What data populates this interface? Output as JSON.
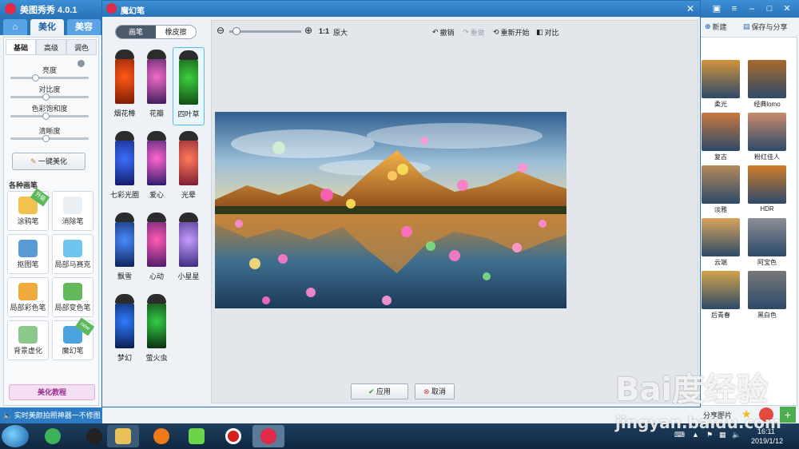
{
  "app": {
    "title": "美图秀秀 4.0.1",
    "tabs": [
      "美化",
      "美容"
    ],
    "toolbar_right": {
      "new_label": "新建",
      "save_label": "保存与分享"
    },
    "left_panel": {
      "sub_tabs": [
        "基础",
        "高级",
        "调色"
      ],
      "sliders": [
        {
          "label": "亮度",
          "value": 0.3
        },
        {
          "label": "对比度",
          "value": 0.45
        },
        {
          "label": "色彩饱和度",
          "value": 0.45
        },
        {
          "label": "清晰度",
          "value": 0.45
        }
      ],
      "one_key_label": "一键美化",
      "brush_header": "各种画笔",
      "brushes": [
        {
          "label": "涂鸦笔",
          "badge": "升级",
          "color": "#f2c14e"
        },
        {
          "label": "消除笔",
          "badge": "",
          "color": "#e9eef3"
        },
        {
          "label": "抠图笔",
          "badge": "",
          "color": "#5b9bd5"
        },
        {
          "label": "局部马赛克",
          "badge": "",
          "color": "#6ec5f0"
        },
        {
          "label": "局部彩色笔",
          "badge": "",
          "color": "#f0a93c"
        },
        {
          "label": "局部变色笔",
          "badge": "",
          "color": "#62b85a"
        },
        {
          "label": "背景虚化",
          "badge": "",
          "color": "#8bc98a"
        },
        {
          "label": "魔幻笔",
          "badge": "new",
          "color": "#4aa3df"
        }
      ],
      "tutorial_label": "美化教程"
    },
    "right_panel": {
      "effects": [
        {
          "label": "柔光",
          "tint": "#d4923a"
        },
        {
          "label": "经典lomo",
          "tint": "#a86a2a"
        },
        {
          "label": "复古",
          "tint": "#c9783d"
        },
        {
          "label": "粉红佳人",
          "tint": "#c98a6a"
        },
        {
          "label": "淡雅",
          "tint": "#b58a5a"
        },
        {
          "label": "HDR",
          "tint": "#d07c2a"
        },
        {
          "label": "云端",
          "tint": "#d9a55a"
        },
        {
          "label": "阿宝色",
          "tint": "#8c8f94"
        },
        {
          "label": "后青春",
          "tint": "#d3a24a"
        },
        {
          "label": "黑白色",
          "tint": "#777777"
        }
      ],
      "share_label": "分享图片"
    },
    "status_text": "实时美颜拍照神器一不修图"
  },
  "dialog": {
    "title": "魔幻笔",
    "modes": [
      "画笔",
      "橡皮擦"
    ],
    "pens": [
      {
        "label": "烟花棒",
        "c1": "#ff5a1a",
        "c2": "#7a1a00",
        "selected": false
      },
      {
        "label": "花瓣",
        "c1": "#f06cc4",
        "c2": "#3a1a5a",
        "selected": false
      },
      {
        "label": "四叶草",
        "c1": "#3ecf3e",
        "c2": "#0f4a12",
        "selected": true
      },
      {
        "label": "七彩光圈",
        "c1": "#3b6fff",
        "c2": "#111a66",
        "selected": false
      },
      {
        "label": "爱心",
        "c1": "#ff66cc",
        "c2": "#2a1a6a",
        "selected": false
      },
      {
        "label": "光晕",
        "c1": "#ff7a5a",
        "c2": "#7a1a30",
        "selected": false
      },
      {
        "label": "飘雪",
        "c1": "#4a8cff",
        "c2": "#0c1f55",
        "selected": false
      },
      {
        "label": "心动",
        "c1": "#ff5ab0",
        "c2": "#4a1a6a",
        "selected": false
      },
      {
        "label": "小星星",
        "c1": "#c49bff",
        "c2": "#3a2a7a",
        "selected": false
      },
      {
        "label": "梦幻",
        "c1": "#2e7bff",
        "c2": "#0a1a4a",
        "selected": false
      },
      {
        "label": "萤火虫",
        "c1": "#33cc44",
        "c2": "#0a2a10",
        "selected": false
      }
    ],
    "toolbar": {
      "ratio_label": "1:1",
      "original_label": "原大",
      "undo_label": "撤销",
      "redo_label": "重做",
      "restart_label": "重新开始",
      "compare_label": "对比"
    },
    "apply_label": "应用",
    "cancel_label": "取消"
  },
  "taskbar": {
    "time": "16:11",
    "date": "2019/1/12"
  },
  "watermark": {
    "logo": "Bai度经验",
    "url": "jingyan.baidu.com"
  }
}
